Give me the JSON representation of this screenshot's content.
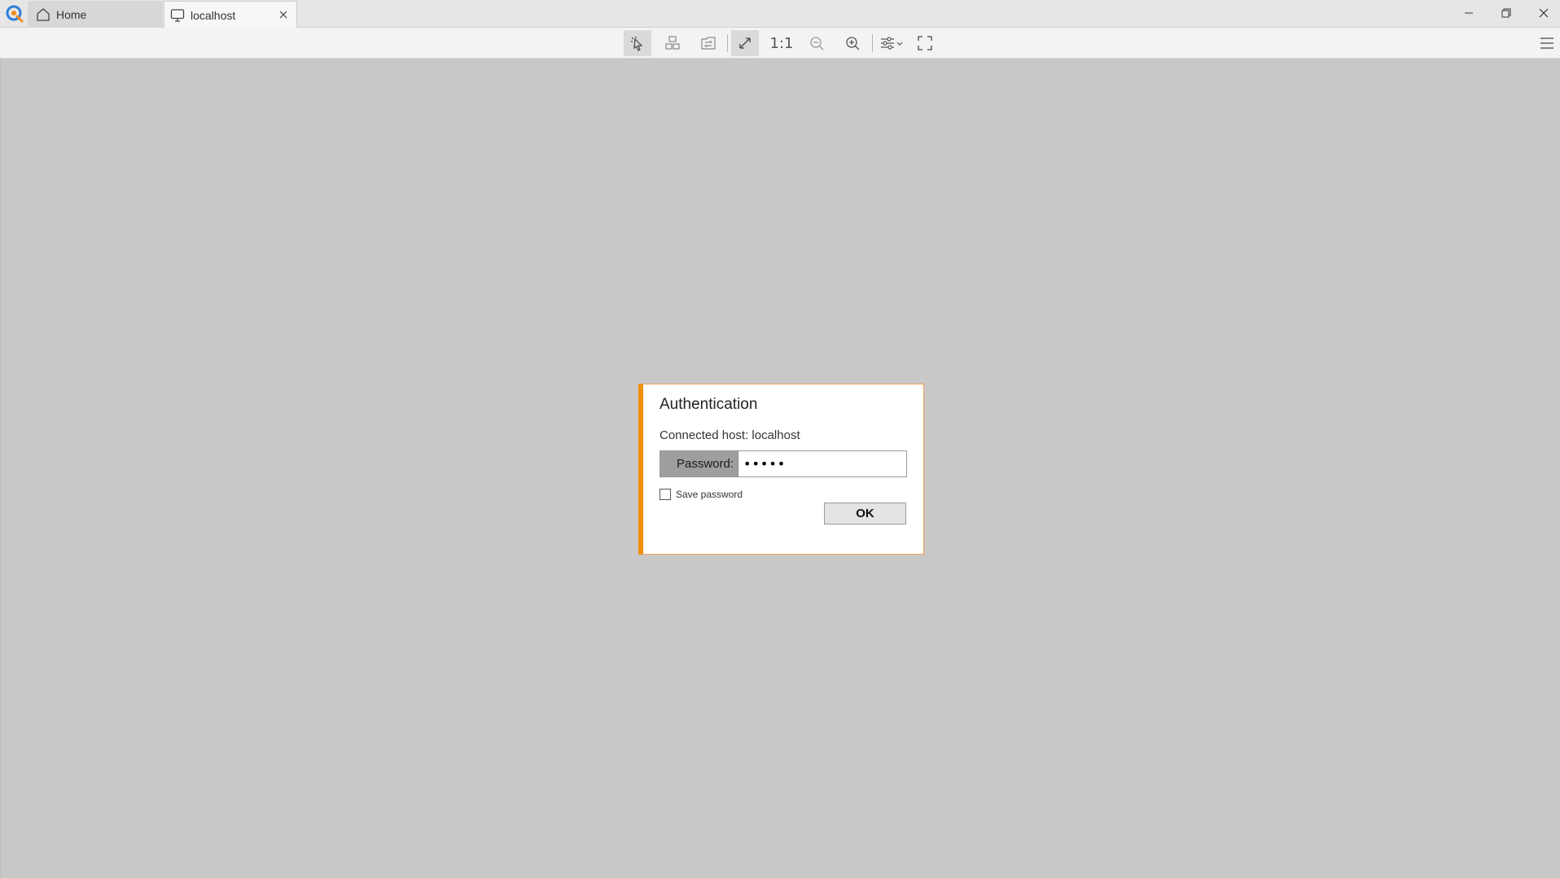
{
  "tabs": [
    {
      "label": "Home",
      "icon": "home-icon"
    },
    {
      "label": "localhost",
      "icon": "monitor-icon"
    }
  ],
  "toolbar": {
    "scale_label": "1:1",
    "buttons": [
      "cursor-icon",
      "grid-icon",
      "transfer-icon",
      "resize-icon",
      "zoom-out-icon",
      "zoom-in-icon",
      "settings-sliders-icon",
      "fullscreen-icon"
    ]
  },
  "dialog": {
    "title": "Authentication",
    "host_text": "Connected host: localhost",
    "password_label": "Password:",
    "password_value": "•••••",
    "save_password_label": "Save password",
    "ok_label": "OK"
  },
  "colors": {
    "accent": "#f0900e",
    "background": "#c8c8c8"
  }
}
